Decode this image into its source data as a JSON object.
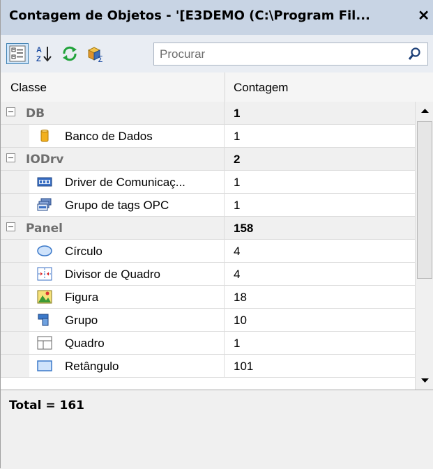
{
  "window": {
    "title": "Contagem de Objetos - '[E3DEMO (C:\\Program Fil...",
    "close_glyph": "✕"
  },
  "toolbar": {
    "buttons": [
      {
        "icon": "categorized-view-icon",
        "active": true
      },
      {
        "icon": "sort-az-icon",
        "active": false
      },
      {
        "icon": "refresh-icon",
        "active": false
      },
      {
        "icon": "sum-objects-icon",
        "active": false
      }
    ],
    "search": {
      "placeholder": "Procurar",
      "value": "",
      "icon": "search-icon"
    }
  },
  "grid": {
    "columns": [
      "Classe",
      "Contagem"
    ],
    "groups": [
      {
        "name": "DB",
        "count": "1",
        "items": [
          {
            "name": "Banco de Dados",
            "count": "1",
            "icon": "database-icon"
          }
        ]
      },
      {
        "name": "IODrv",
        "count": "2",
        "items": [
          {
            "name": "Driver de Comunicaç...",
            "count": "1",
            "icon": "opc-driver-icon"
          },
          {
            "name": "Grupo de tags OPC",
            "count": "1",
            "icon": "opc-tag-group-icon"
          }
        ]
      },
      {
        "name": "Panel",
        "count": "158",
        "items": [
          {
            "name": "Círculo",
            "count": "4",
            "icon": "circle-icon"
          },
          {
            "name": "Divisor de Quadro",
            "count": "4",
            "icon": "frame-divider-icon"
          },
          {
            "name": "Figura",
            "count": "18",
            "icon": "figure-icon"
          },
          {
            "name": "Grupo",
            "count": "10",
            "icon": "group-icon"
          },
          {
            "name": "Quadro",
            "count": "1",
            "icon": "frame-icon"
          },
          {
            "name": "Retângulo",
            "count": "101",
            "icon": "rectangle-icon"
          }
        ]
      }
    ]
  },
  "footer": {
    "total_text": "Total = 161"
  },
  "colors": {
    "titlebar": "#c8d4e4",
    "toolbar": "#e9edf3",
    "group_row": "#f0f0f0",
    "accent": "#3c7fb1"
  }
}
